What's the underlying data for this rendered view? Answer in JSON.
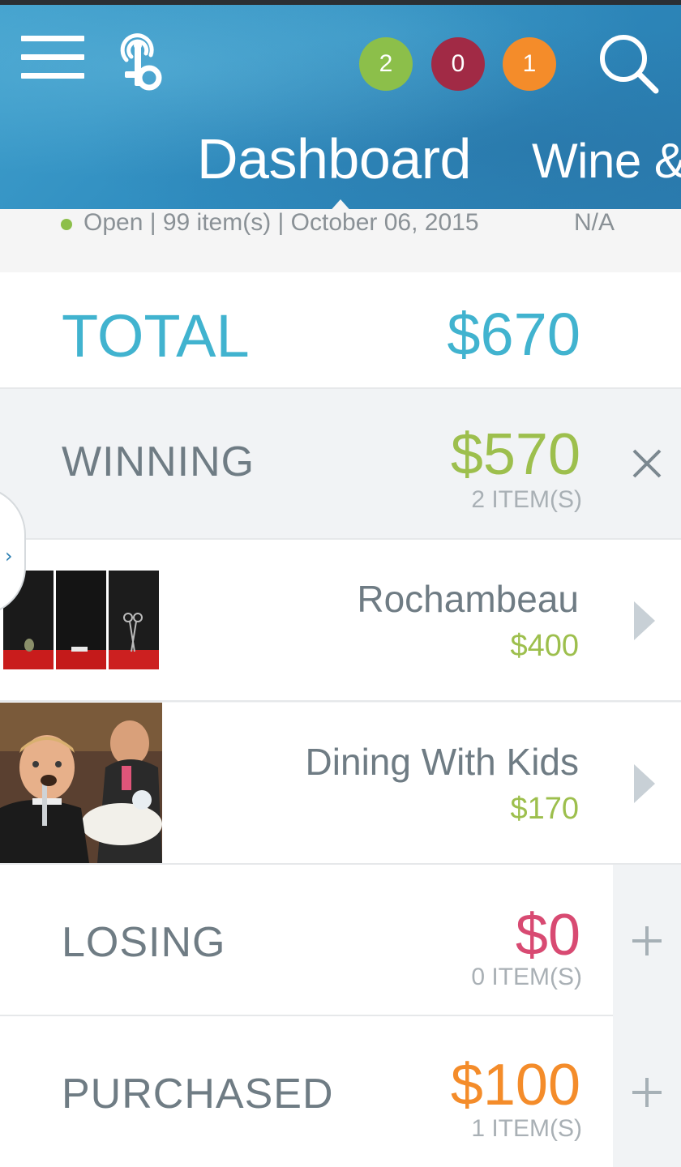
{
  "header": {
    "badges": [
      {
        "count": "2",
        "color": "#8cbf4a"
      },
      {
        "count": "0",
        "color": "#a12a45"
      },
      {
        "count": "1",
        "color": "#f48c2a"
      }
    ],
    "tabs": [
      {
        "label": "Dashboard",
        "active": true
      },
      {
        "label": "Wine &",
        "active": false
      }
    ],
    "icons": {
      "menu": "hamburger-menu-icon",
      "logo": "app-logo-icon",
      "search": "search-icon"
    }
  },
  "status": {
    "state_dot_color": "#8cbf4a",
    "text": "Open | 99 item(s) | October 06, 2015",
    "right": "N/A"
  },
  "summary": {
    "total": {
      "label": "TOTAL",
      "amount": "$670",
      "color": "#41b3cf"
    },
    "winning": {
      "label": "WINNING",
      "amount": "$570",
      "count": "2 ITEM(S)",
      "color": "#9dbf4d",
      "action_icon": "close-icon"
    },
    "losing": {
      "label": "LOSING",
      "amount": "$0",
      "count": "0 ITEM(S)",
      "color": "#d84a72",
      "action_icon": "plus-icon"
    },
    "purchased": {
      "label": "PURCHASED",
      "amount": "$100",
      "count": "1 ITEM(S)",
      "color": "#f48c2a",
      "action_icon": "plus-icon"
    }
  },
  "winning_items": [
    {
      "name": "Rochambeau",
      "price": "$400",
      "thumbnail": "rock-paper-scissors-photo"
    },
    {
      "name": "Dining With Kids",
      "price": "$170",
      "thumbnail": "child-dining-photo"
    }
  ],
  "side_panel": {
    "icon": "chevron-right-icon",
    "glyph": "›"
  }
}
